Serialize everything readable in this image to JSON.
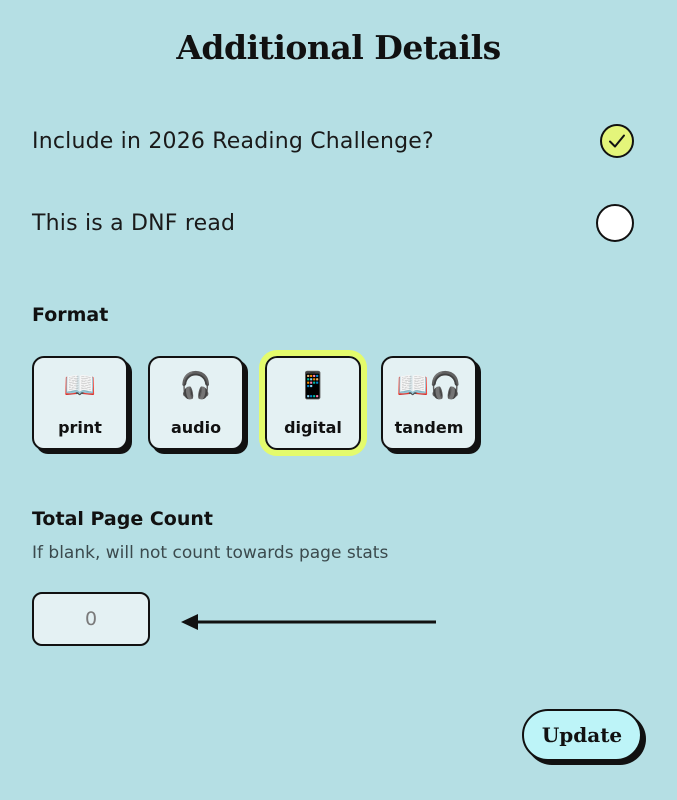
{
  "header": {
    "title": "Additional Details"
  },
  "toggles": [
    {
      "label": "Include in 2026 Reading Challenge?",
      "checked": true
    },
    {
      "label": "This is a DNF read",
      "checked": false
    }
  ],
  "format": {
    "title": "Format",
    "selected": "digital",
    "options": [
      {
        "label": "print",
        "emoji": "📖"
      },
      {
        "label": "audio",
        "emoji": "🎧"
      },
      {
        "label": "digital",
        "emoji": "📱"
      },
      {
        "label": "tandem",
        "emoji": "📖🎧"
      }
    ]
  },
  "page_count": {
    "title": "Total Page Count",
    "hint": "If blank, will not count towards page stats",
    "placeholder": "0",
    "value": ""
  },
  "actions": {
    "update_label": "Update"
  },
  "colors": {
    "background": "#b5dfe4",
    "checked_fill": "#e4f57a",
    "selected_outline": "#e4fb6c",
    "card_fill": "#e4f1f3",
    "button_fill": "#bdf4f8"
  }
}
